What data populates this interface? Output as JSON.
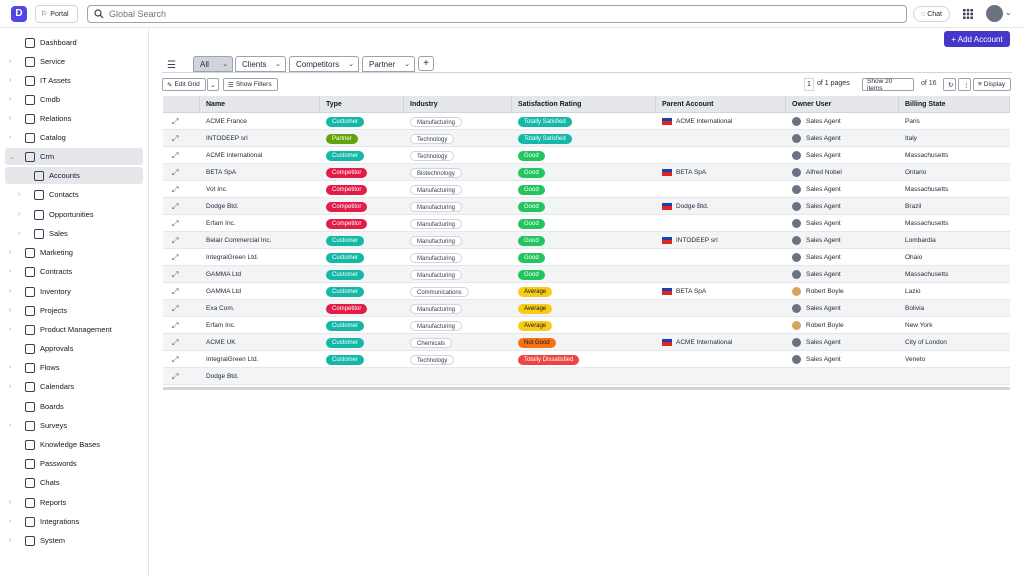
{
  "topbar": {
    "portal_label": "Portal",
    "search_placeholder": "Global Search",
    "chat_label": "Chat"
  },
  "sidebar": {
    "items": [
      {
        "label": "Dashboard",
        "chevron": false,
        "icon": "dashboard-icon"
      },
      {
        "label": "Service",
        "chevron": true,
        "icon": "service-icon"
      },
      {
        "label": "IT Assets",
        "chevron": true,
        "icon": "wifi-icon"
      },
      {
        "label": "Cmdb",
        "chevron": true,
        "icon": "database-icon"
      },
      {
        "label": "Relations",
        "chevron": true,
        "icon": "relations-icon"
      },
      {
        "label": "Catalog",
        "chevron": true,
        "icon": "catalog-icon"
      },
      {
        "label": "Crm",
        "chevron": true,
        "icon": "crm-icon",
        "expanded": true
      },
      {
        "label": "Accounts",
        "chevron": false,
        "icon": "building-icon",
        "sub": true,
        "active": true
      },
      {
        "label": "Contacts",
        "chevron": true,
        "icon": "contacts-icon",
        "sub": true
      },
      {
        "label": "Opportunities",
        "chevron": true,
        "icon": "document-icon",
        "sub": true
      },
      {
        "label": "Sales",
        "chevron": true,
        "icon": "tag-icon",
        "sub": true
      },
      {
        "label": "Marketing",
        "chevron": true,
        "icon": "megaphone-icon"
      },
      {
        "label": "Contracts",
        "chevron": true,
        "icon": "contracts-icon"
      },
      {
        "label": "Inventory",
        "chevron": true,
        "icon": "inventory-icon"
      },
      {
        "label": "Projects",
        "chevron": true,
        "icon": "projects-icon"
      },
      {
        "label": "Product Management",
        "chevron": true,
        "icon": "product-icon"
      },
      {
        "label": "Approvals",
        "chevron": false,
        "icon": "approvals-icon"
      },
      {
        "label": "Flows",
        "chevron": true,
        "icon": "flows-icon"
      },
      {
        "label": "Calendars",
        "chevron": true,
        "icon": "calendar-icon"
      },
      {
        "label": "Boards",
        "chevron": false,
        "icon": "boards-icon"
      },
      {
        "label": "Surveys",
        "chevron": true,
        "icon": "surveys-icon"
      },
      {
        "label": "Knowledge Bases",
        "chevron": false,
        "icon": "knowledge-icon"
      },
      {
        "label": "Passwords",
        "chevron": false,
        "icon": "key-icon"
      },
      {
        "label": "Chats",
        "chevron": false,
        "icon": "chat-icon"
      },
      {
        "label": "Reports",
        "chevron": true,
        "icon": "reports-icon"
      },
      {
        "label": "Integrations",
        "chevron": true,
        "icon": "integrations-icon"
      },
      {
        "label": "System",
        "chevron": true,
        "icon": "globe-icon"
      }
    ]
  },
  "main": {
    "add_button": "+ Add Account",
    "tabs": [
      "All",
      "Clients",
      "Competitors",
      "Partner"
    ],
    "toolbar": {
      "edit_grid": "Edit Grid",
      "show_filters": "Show Filters",
      "page": "1",
      "of_pages": "of 1 pages",
      "show_items": "Show 20 items",
      "of_total": "of 16",
      "display": "Display"
    },
    "columns": [
      "Name",
      "Type",
      "Industry",
      "Satisfaction Rating",
      "Parent Account",
      "Owner User",
      "Billing State"
    ],
    "rows": [
      {
        "name": "ACME France",
        "type": "Customer",
        "industry": "Manufacturing",
        "rating": "Totally Satisfied",
        "parent": "ACME International",
        "owner": "Sales Agent",
        "state": "Paris"
      },
      {
        "name": "INTODEEP srl",
        "type": "Partner",
        "industry": "Technology",
        "rating": "Totally Satisfied",
        "parent": "",
        "owner": "Sales Agent",
        "state": "Italy"
      },
      {
        "name": "ACME International",
        "type": "Customer",
        "industry": "Technology",
        "rating": "Good",
        "parent": "",
        "owner": "Sales Agent",
        "state": "Massachusetts"
      },
      {
        "name": "BETA SpA",
        "type": "Competitor",
        "industry": "Biotechnology",
        "rating": "Good",
        "parent": "BETA SpA",
        "owner": "Alfred Nobel",
        "state": "Ontario"
      },
      {
        "name": "Vot Inc.",
        "type": "Competitor",
        "industry": "Manufacturing",
        "rating": "Good",
        "parent": "",
        "owner": "Sales Agent",
        "state": "Massachusetts"
      },
      {
        "name": "Dodge Btd.",
        "type": "Competitor",
        "industry": "Manufacturing",
        "rating": "Good",
        "parent": "Dodge Btd.",
        "owner": "Sales Agent",
        "state": "Brazil"
      },
      {
        "name": "Erfam Inc.",
        "type": "Competitor",
        "industry": "Manufacturing",
        "rating": "Good",
        "parent": "",
        "owner": "Sales Agent",
        "state": "Massachusetts"
      },
      {
        "name": "Belair Commercial Inc.",
        "type": "Customer",
        "industry": "Manufacturing",
        "rating": "Good",
        "parent": "INTODEEP srl",
        "owner": "Sales Agent",
        "state": "Lombardia"
      },
      {
        "name": "IntegralGreen Ltd.",
        "type": "Customer",
        "industry": "Manufacturing",
        "rating": "Good",
        "parent": "",
        "owner": "Sales Agent",
        "state": "Ohaio"
      },
      {
        "name": "GAMMA Ltd",
        "type": "Customer",
        "industry": "Manufacturing",
        "rating": "Good",
        "parent": "",
        "owner": "Sales Agent",
        "state": "Massachusetts"
      },
      {
        "name": "GAMMA Ltd",
        "type": "Customer",
        "industry": "Communications",
        "rating": "Average",
        "parent": "BETA SpA",
        "owner": "Robert Boyle",
        "state": "Lazio"
      },
      {
        "name": "Exa Com.",
        "type": "Competitor",
        "industry": "Manufacturing",
        "rating": "Average",
        "parent": "",
        "owner": "Sales Agent",
        "state": "Bolivia"
      },
      {
        "name": "Erfam Inc.",
        "type": "Customer",
        "industry": "Manufacturing",
        "rating": "Average",
        "parent": "",
        "owner": "Robert Boyle",
        "state": "New York"
      },
      {
        "name": "ACME UK",
        "type": "Customer",
        "industry": "Chemicals",
        "rating": "Not Good",
        "parent": "ACME International",
        "owner": "Sales Agent",
        "state": "City of London"
      },
      {
        "name": "IntegralGreen Ltd.",
        "type": "Customer",
        "industry": "Technology",
        "rating": "Totally Dissatisfied",
        "parent": "",
        "owner": "Sales Agent",
        "state": "Veneto"
      },
      {
        "name": "Dodge Btd.",
        "type": "",
        "industry": "",
        "rating": "",
        "parent": "",
        "owner": "",
        "state": ""
      }
    ]
  }
}
